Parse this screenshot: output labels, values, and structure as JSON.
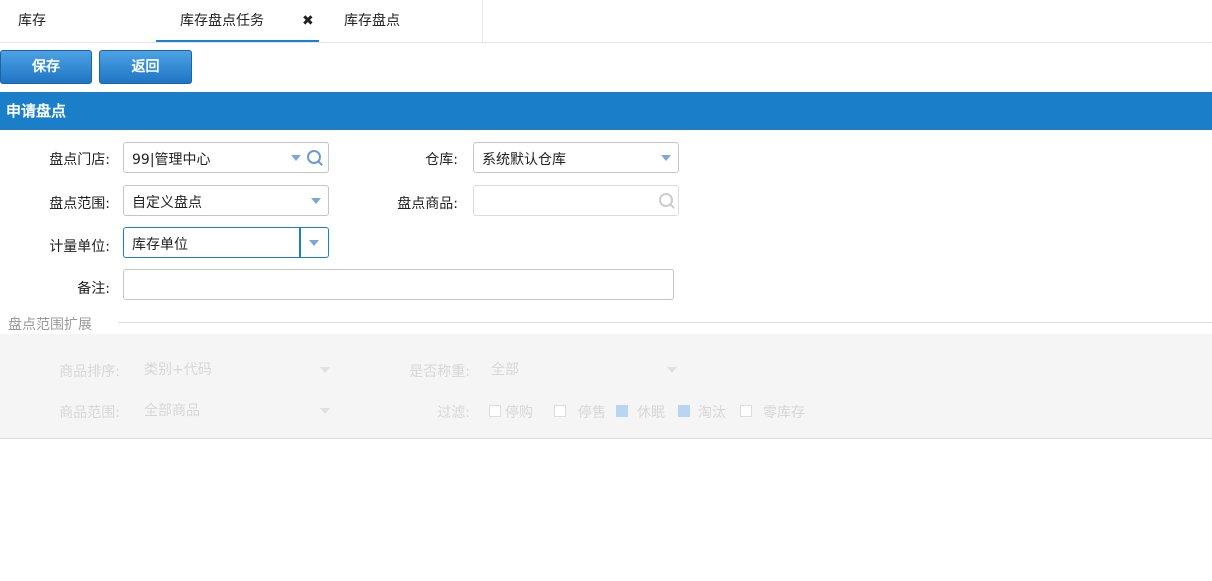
{
  "tabs": {
    "root": "库存",
    "active": "库存盘点任务",
    "third": "库存盘点"
  },
  "toolbar": {
    "save": "保存",
    "back": "返回"
  },
  "section": {
    "title": "申请盘点"
  },
  "form": {
    "store_label": "盘点门店:",
    "store_value": "99|管理中心",
    "warehouse_label": "仓库:",
    "warehouse_value": "系统默认仓库",
    "range_label": "盘点范围:",
    "range_value": "自定义盘点",
    "goods_label": "盘点商品:",
    "goods_value": "",
    "unit_label": "计量单位:",
    "unit_value": "库存单位",
    "remark_label": "备注:",
    "remark_value": ""
  },
  "ext": {
    "title": "盘点范围扩展",
    "sort_label": "商品排序:",
    "sort_value": "类别+代码",
    "weigh_label": "是否称重:",
    "weigh_value": "全部",
    "scope_label": "商品范围:",
    "scope_value": "全部商品",
    "filter_label": "过滤:",
    "filters": [
      {
        "label": "停购",
        "checked": false
      },
      {
        "label": "停售",
        "checked": false
      },
      {
        "label": "休眠",
        "checked": true
      },
      {
        "label": "淘汰",
        "checked": true
      },
      {
        "label": "零库存",
        "checked": false
      }
    ]
  },
  "colors": {
    "accent": "#1a7fc8"
  }
}
